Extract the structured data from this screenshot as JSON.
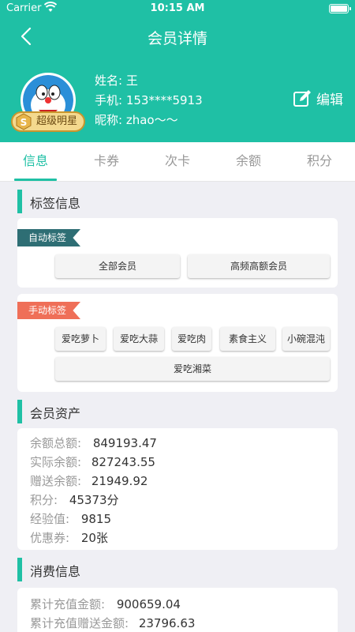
{
  "status_bar": {
    "carrier": "Carrier",
    "time": "10:15 AM"
  },
  "nav": {
    "title": "会员详情"
  },
  "member": {
    "badge": "超级明星",
    "name_label": "姓名:",
    "name": "王",
    "phone_label": "手机:",
    "phone": "153****5913",
    "nickname_label": "昵称:",
    "nickname": "zhao～～",
    "edit_label": "编辑"
  },
  "tabs": [
    "信息",
    "卡券",
    "次卡",
    "余额",
    "积分"
  ],
  "tag_section": {
    "title": "标签信息",
    "auto_label": "自动标签",
    "auto_tags": [
      "全部会员",
      "高频高额会员"
    ],
    "manual_label": "手动标签",
    "manual_tags": [
      "爱吃萝卜",
      "爱吃大蒜",
      "爱吃肉",
      "素食主义",
      "小碗混沌",
      "爱吃湘菜"
    ]
  },
  "assets": {
    "title": "会员资产",
    "rows": [
      {
        "label": "余额总额:",
        "value": "849193.47"
      },
      {
        "label": "实际余额:",
        "value": "827243.55"
      },
      {
        "label": "赠送余额:",
        "value": "21949.92"
      },
      {
        "label": "积分:",
        "value": "45373分"
      },
      {
        "label": "经验值:",
        "value": "9815"
      },
      {
        "label": "优惠券:",
        "value": "20张"
      }
    ]
  },
  "consumption": {
    "title": "消费信息",
    "rows": [
      {
        "label": "累计充值金额:",
        "value": "900659.04"
      },
      {
        "label": "累计充值赠送金额:",
        "value": "23796.63"
      }
    ]
  },
  "colors": {
    "primary": "#1fc0a5",
    "auto_tag": "#2e6e74",
    "manual_tag": "#ef6f58"
  }
}
